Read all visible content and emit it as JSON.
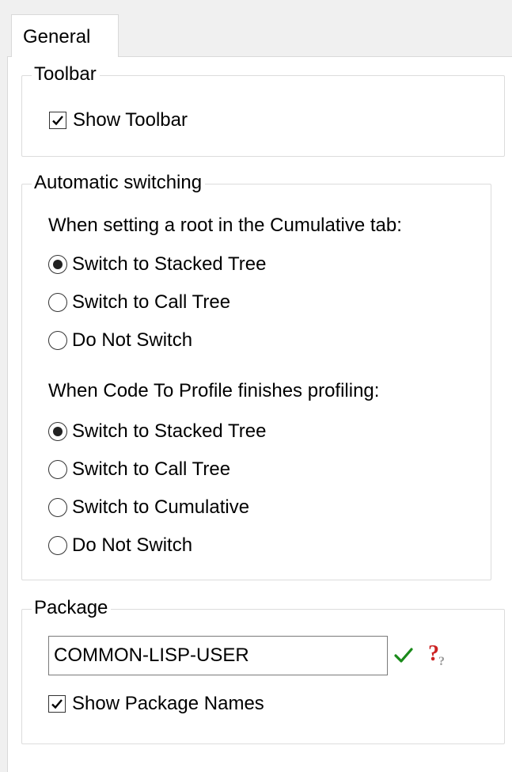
{
  "tabs": [
    {
      "label": "General",
      "active": true
    }
  ],
  "toolbar_group": {
    "title": "Toolbar",
    "show_toolbar": {
      "label": "Show Toolbar",
      "checked": true
    }
  },
  "switching_group": {
    "title": "Automatic switching",
    "cumulative_prompt": "When setting a root in the Cumulative tab:",
    "cumulative_options": [
      {
        "label": "Switch to Stacked Tree",
        "selected": true
      },
      {
        "label": "Switch to Call Tree",
        "selected": false
      },
      {
        "label": "Do Not Switch",
        "selected": false
      }
    ],
    "profile_prompt": "When Code To Profile finishes profiling:",
    "profile_options": [
      {
        "label": "Switch to Stacked Tree",
        "selected": true
      },
      {
        "label": "Switch to Call Tree",
        "selected": false
      },
      {
        "label": "Switch to Cumulative",
        "selected": false
      },
      {
        "label": "Do Not Switch",
        "selected": false
      }
    ]
  },
  "package_group": {
    "title": "Package",
    "value": "COMMON-LISP-USER",
    "accept_icon": "checkmark-icon",
    "help_icon": "help-icon",
    "accept_color": "#1a8a1a",
    "help_color": "#cc2222",
    "show_package_names": {
      "label": "Show Package Names",
      "checked": true
    }
  }
}
